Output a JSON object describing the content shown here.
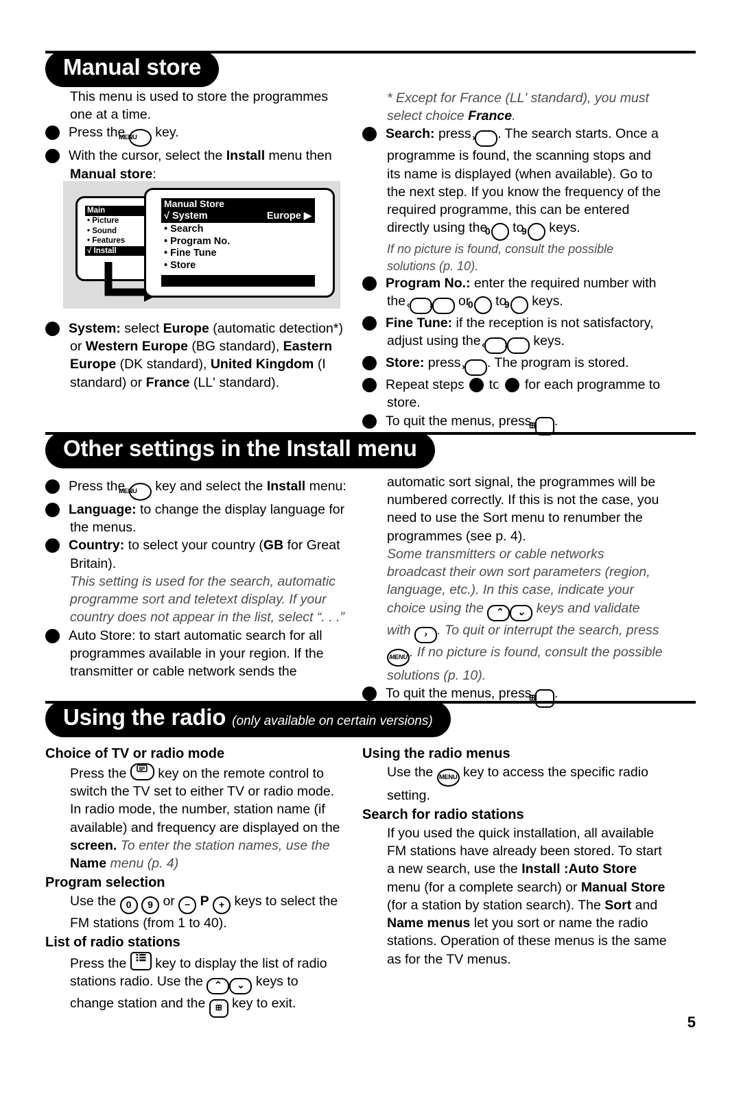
{
  "page_number": "5",
  "sections": [
    {
      "id": "manual-store",
      "title": "Manual store",
      "subtitle": "",
      "left": {
        "intro": "This menu is used to store the programmes one at a time.",
        "step1_pre": "Press the",
        "step1_post": "key.",
        "step2_a": "With the cursor, select the ",
        "step2_b": "Install",
        "step2_c": " menu then ",
        "step2_d": "Manual store",
        "step2_e": ":",
        "step3": "System: select Europe (automatic detection*) or Western Europe (BG standard), Eastern Europe (DK standard), United Kingdom (I standard) or France (LL' standard)."
      },
      "right": {
        "footnote_a": "* Except for France (LL' standard), you must select choice ",
        "footnote_b": "France",
        "footnote_c": ".",
        "step4_label": "Search:",
        "step4_a": " press ",
        "step4_b": ". The search starts. Once a programme is found, the scanning stops and its name is displayed (when available). Go to the next step. If you know the frequency of the required programme, this can be entered directly using the ",
        "step4_c": " to ",
        "step4_d": " keys.",
        "step4_note": "If no picture is found, consult the possible solutions (p. 10).",
        "step5_label": "Program No.:",
        "step5_a": " enter the required number with the ",
        "step5_b": " or ",
        "step5_c": " to ",
        "step5_d": " keys.",
        "step6_label": "Fine Tune:",
        "step6_a": " if the reception is not satisfactory, adjust using the ",
        "step6_b": " keys.",
        "step7_label": "Store:",
        "step7_a": " press ",
        "step7_b": ". The program is stored.",
        "step8_a": "Repeat steps ",
        "step8_b": " to ",
        "step8_c": " for each programme to store.",
        "step9_a": "To quit the menus, press ",
        "step9_b": "."
      }
    },
    {
      "id": "other-settings",
      "title": "Other settings in the Install menu",
      "subtitle": "",
      "left": {
        "step1_a": "Press the ",
        "step1_b": " key and select the ",
        "step1_c": "Install",
        "step1_d": " menu:",
        "step2_label": "Language:",
        "step2_text": " to change the display language for the menus.",
        "step3_label": "Country:",
        "step3_a": " to select your country (",
        "step3_b": "GB",
        "step3_c": " for Great Britain).",
        "step3_note": "This setting is used for the search, automatic programme sort and teletext display. If your country does not appear in the list, select “. . .”",
        "step4_text": "Auto Store: to start automatic search for all programmes available in your region. If the transmitter or cable network sends the"
      },
      "right": {
        "cont_text": "automatic sort signal, the programmes will be numbered correctly. If this is not the case, you need to use the Sort menu to renumber the programmes (see p. 4).",
        "note_a": "Some transmitters or cable networks broadcast their own sort parameters (region, language, etc.). In this case, indicate your choice using the ",
        "note_b": " keys and validate with ",
        "note_c": ". To quit or interrupt the search, press ",
        "note_d": ". If no picture is found, consult the possible solutions (p. 10).",
        "step5_a": "To quit the menus, press ",
        "step5_b": "."
      }
    },
    {
      "id": "using-the-radio",
      "title": "Using the radio",
      "subtitle": "(only available on certain versions)",
      "left": {
        "h1": "Choice of TV or radio mode",
        "h1_a": "Press the ",
        "h1_b": " key on the remote control to switch the TV set to either TV or radio mode. In radio mode, the number, station name (if available) and frequency are displayed on the ",
        "h1_c": "screen.",
        "h1_d": " To enter the station names, use the ",
        "h1_e": "Name",
        "h1_f": " menu (p. 4)",
        "h2": "Program selection",
        "h2_a": "Use the ",
        "h2_b": " ",
        "h2_c": " or ",
        "h2_d": " ",
        "h2_e": "P",
        "h2_f": " ",
        "h2_g": " keys to select the FM stations (from 1 to 40).",
        "h3": "List of radio stations",
        "h3_a": "Press the ",
        "h3_b": " key to display the list of radio stations radio. Use the ",
        "h3_c": " keys to change station and the ",
        "h3_d": " key to exit."
      },
      "right": {
        "h1": "Using the radio menus",
        "h1_a": "Use the ",
        "h1_b": " key to access the specific radio setting.",
        "h2": "Search for radio stations",
        "h2_a": "If you used the quick installation, all available FM stations have already been stored. To start a new search, use the ",
        "h2_b": "Install :Auto Store",
        "h2_c": " menu (for a complete search) or ",
        "h2_d": "Manual Store",
        "h2_e": " (for a station by station search). The ",
        "h2_f": "Sort",
        "h2_g": " and ",
        "h2_h": "Name menus",
        "h2_i": " let you sort or name the radio stations. Operation of these menus is the same as for the TV menus."
      }
    }
  ],
  "osd_diagram": {
    "main_menu": {
      "title": "Main",
      "items": [
        {
          "label": "Picture",
          "marker": "bullet",
          "highlighted": false
        },
        {
          "label": "Sound",
          "marker": "bullet",
          "highlighted": false
        },
        {
          "label": "Features",
          "marker": "bullet",
          "highlighted": false
        },
        {
          "label": "Install",
          "marker": "check",
          "highlighted": true
        }
      ]
    },
    "store_menu": {
      "title": "Manual Store",
      "selected": {
        "label": "System",
        "marker": "check",
        "value": "Europe",
        "arrow": "▶"
      },
      "items": [
        {
          "label": "Search",
          "marker": "bullet"
        },
        {
          "label": "Program No.",
          "marker": "bullet"
        },
        {
          "label": "Fine Tune",
          "marker": "bullet"
        },
        {
          "label": "Store",
          "marker": "bullet"
        }
      ]
    }
  },
  "keys": {
    "menu": "MENU",
    "right": "›",
    "left": "‹",
    "up": "⌃",
    "down": "⌄",
    "zero": "0",
    "nine": "9",
    "minus": "−",
    "plus": "+",
    "p": "P"
  },
  "colors": {
    "banner_bg": "#000000",
    "banner_text": "#ffffff",
    "diagram_bg": "#dcdcdc",
    "italic_note": "#4d4d4d"
  }
}
